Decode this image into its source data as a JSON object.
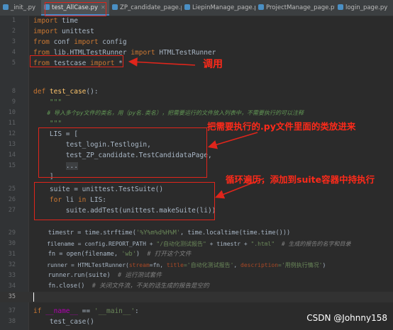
{
  "tabs": [
    {
      "label": "_init_.py",
      "active": false
    },
    {
      "label": "test_AllCase.py",
      "active": true
    },
    {
      "label": "ZP_candidate_page.py",
      "active": false
    },
    {
      "label": "LiepinManage_page.py",
      "active": false
    },
    {
      "label": "ProjectManage_page.py",
      "active": false
    },
    {
      "label": "login_page.py",
      "active": false
    }
  ],
  "line_numbers": [
    "1",
    "2",
    "3",
    "4",
    "5",
    "",
    "",
    "8",
    "9",
    "10",
    "11",
    "12",
    "13",
    "14",
    "15",
    "",
    "25",
    "26",
    "27",
    "",
    "29",
    "30",
    "31",
    "32",
    "33",
    "34",
    "35",
    "",
    "37",
    "38"
  ],
  "code": {
    "l1": {
      "kw": "import",
      "rest": " time"
    },
    "l2": {
      "kw": "import",
      "rest": " unittest"
    },
    "l3": {
      "kw1": "from",
      "mid": " conf ",
      "kw2": "import",
      "rest": " config"
    },
    "l4": {
      "kw1": "from",
      "mid": " lib.HTMLTestRunner ",
      "kw2": "import",
      "rest": " HTMLTestRunner"
    },
    "l5": {
      "kw1": "from",
      "mid": " testcase ",
      "kw2": "import",
      "rest": " *"
    },
    "l8": {
      "kw": "def",
      "fn": "test_case",
      "rest": "():"
    },
    "l9": "\"\"\"",
    "l10": "# 导入多个py文件的类名，用（py名.类名），把需要运行的文件放入列表中，不需要执行的可以注释",
    "l11": "\"\"\"",
    "l12": "LIS = [",
    "l13": "test_login.Testlogin,",
    "l14": "test_ZP_candidate.TestCandidataPage,",
    "l15": "...",
    "l16": "]",
    "l25": "suite = unittest.TestSuite()",
    "l26": {
      "kw1": "for",
      "mid": " li ",
      "kw2": "in",
      "rest": " LIS:"
    },
    "l27": "suite.addTest(unittest.makeSuite(li))",
    "l29": {
      "a": "timestr = time.strftime(",
      "s": "'%Y%m%d%H%M'",
      "b": ", time.localtime(time.time()))"
    },
    "l30": {
      "a": "filename = config.REPORT_PATH + ",
      "s1": "\"/自动化测试报告\"",
      "b": " + timestr + ",
      "s2": "\".html\"",
      "c": "  # 生成的报告的名字和目录"
    },
    "l31": {
      "a": "fn = open(filename, ",
      "s": "'wb'",
      "b": ")  ",
      "c": "# 打开这个文件"
    },
    "l32": {
      "a": "runner = HTMLTestRunner(",
      "p1": "stream",
      "b": "=fn, ",
      "p2": "title",
      "s1": "='自动化测试报告'",
      "b2": ", ",
      "p3": "description",
      "s2": "='用例执行情况'",
      "c": ")"
    },
    "l33": {
      "a": "runner.run(suite)  ",
      "c": "# 运行测试套件"
    },
    "l34": {
      "a": "fn.close()  ",
      "c": "# 关闭文件流，不关的话生成的报告是空的"
    },
    "l37": {
      "kw1": "if",
      "d1": "__name__",
      "op": " == ",
      "s": "'__main__'",
      "rest": ":"
    },
    "l38": "test_case()"
  },
  "annotations": {
    "call": "调用",
    "put_classes": "把需要执行的.py文件里面的类放进来",
    "loop": "循环遍历，添加到suite容器中持执行"
  },
  "watermark": "CSDN @Johnny158",
  "colors": {
    "annotation": "#ff2a1a",
    "keyword": "#cc7832",
    "string": "#6a8759",
    "comment": "#808080"
  }
}
